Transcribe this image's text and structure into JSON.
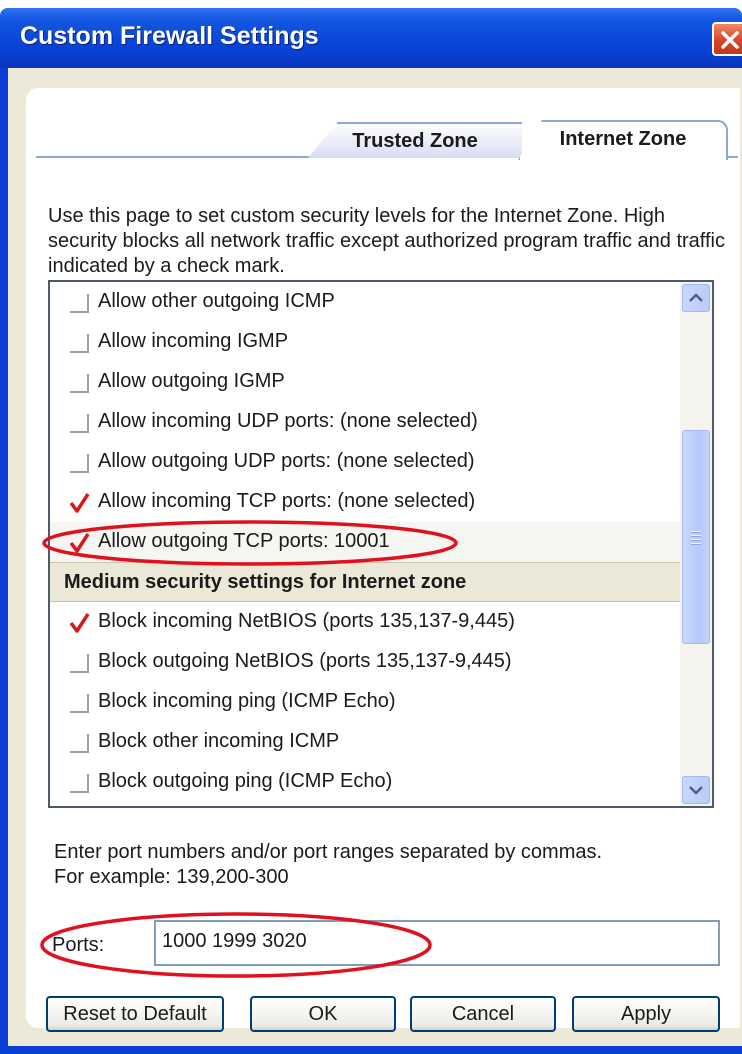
{
  "window": {
    "title": "Custom Firewall Settings"
  },
  "tabs": [
    {
      "label": "Trusted Zone"
    },
    {
      "label": "Internet Zone"
    }
  ],
  "description": "Use this page to set custom security levels for the Internet Zone.  High security blocks all network traffic except authorized program traffic and traffic indicated by a check mark.",
  "list": {
    "items": [
      {
        "label": "Allow other outgoing ICMP",
        "checked": false
      },
      {
        "label": "Allow incoming IGMP",
        "checked": false
      },
      {
        "label": "Allow outgoing IGMP",
        "checked": false
      },
      {
        "label": "Allow incoming UDP ports: (none selected)",
        "checked": false
      },
      {
        "label": "Allow outgoing UDP ports: (none selected)",
        "checked": false
      },
      {
        "label": "Allow incoming TCP ports: (none selected)",
        "checked": true
      },
      {
        "label": "Allow outgoing TCP ports: 10001",
        "checked": true
      }
    ],
    "section_header": "Medium security settings for Internet zone",
    "items2": [
      {
        "label": "Block incoming NetBIOS (ports 135,137-9,445)",
        "checked": true
      },
      {
        "label": "Block outgoing NetBIOS (ports 135,137-9,445)",
        "checked": false
      },
      {
        "label": "Block incoming ping (ICMP Echo)",
        "checked": false
      },
      {
        "label": "Block other incoming ICMP",
        "checked": false
      },
      {
        "label": "Block outgoing ping (ICMP Echo)",
        "checked": false
      }
    ]
  },
  "hint": {
    "line1": "Enter port numbers and/or port ranges separated by commas.",
    "line2": "For example: 139,200-300"
  },
  "ports": {
    "label": "Ports:",
    "value": "1000 1999 3020"
  },
  "buttons": {
    "reset": "Reset to Default",
    "ok": "OK",
    "cancel": "Cancel",
    "apply": "Apply"
  },
  "colors": {
    "titlebar": "#0a46d8",
    "highlight_ellipse": "#e0101e",
    "checkmark": "#d81818"
  }
}
